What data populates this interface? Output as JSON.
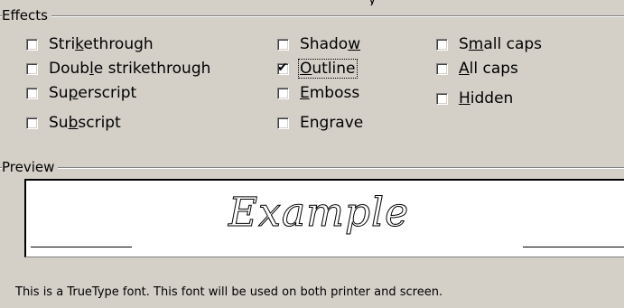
{
  "title_fragment": "y",
  "effects": {
    "group_label": "Effects",
    "checkboxes": [
      {
        "pre": "Stri",
        "key": "k",
        "post": "ethrough",
        "checked": false
      },
      {
        "pre": "Doub",
        "key": "l",
        "post": "e strikethrough",
        "checked": false
      },
      {
        "pre": "Su",
        "key": "p",
        "post": "erscript",
        "checked": false
      },
      {
        "pre": "Su",
        "key": "b",
        "post": "script",
        "checked": false
      },
      {
        "pre": "Shado",
        "key": "w",
        "post": "",
        "checked": false
      },
      {
        "pre": "",
        "key": "O",
        "post": "utline",
        "checked": true
      },
      {
        "pre": "",
        "key": "E",
        "post": "mboss",
        "checked": false
      },
      {
        "pre": "En",
        "key": "g",
        "post": "rave",
        "checked": false
      },
      {
        "pre": "S",
        "key": "m",
        "post": "all caps",
        "checked": false
      },
      {
        "pre": "",
        "key": "A",
        "post": "ll caps",
        "checked": false
      },
      {
        "pre": "",
        "key": "H",
        "post": "idden",
        "checked": false
      }
    ],
    "check_glyph": "✔"
  },
  "preview": {
    "group_label": "Preview",
    "sample_text": "Example"
  },
  "footer_text": "This is a TrueType font. This font will be used on both printer and screen."
}
